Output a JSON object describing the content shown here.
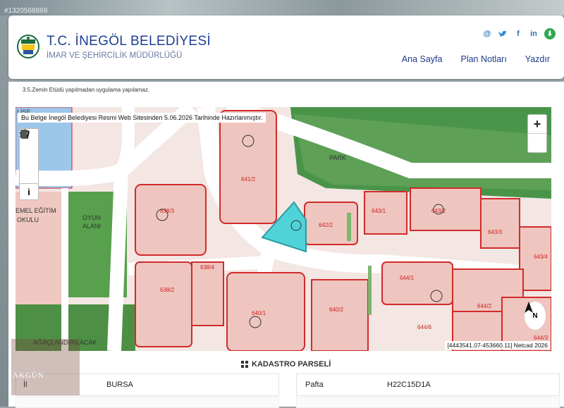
{
  "background_id": "#1320568869",
  "header": {
    "title": "T.C. İNEGÖL BELEDİYESİ",
    "subtitle": "İMAR VE ŞEHİRCİLİK MÜDÜRLÜĞÜ",
    "nav": [
      "Ana Sayfa",
      "Plan Notları",
      "Yazdır"
    ],
    "social_icons": [
      "email-icon",
      "twitter-icon",
      "facebook-icon",
      "linkedin-icon",
      "download-icon"
    ]
  },
  "content": {
    "note": "3.5.Zemin Etüdü yapılmadan uygulama yapılamaz.",
    "map": {
      "banner": "Bu Belge İnegöl Belediyesi Resmi Web Sitesinden 5.06.2026 Tarihinde Hazırlanmıştır.",
      "coords": "[4443541.07-453660.11] Netcad 2026",
      "north_label": "N",
      "zoom_in": "+",
      "info": "i",
      "parcels": [
        "641/2",
        "642/2",
        "643/1",
        "643/2",
        "643/3",
        "643/4",
        "644/1",
        "644/2",
        "644/3",
        "644/6",
        "640/1",
        "640/2",
        "638/2",
        "638/3",
        "638/4",
        "639/1"
      ],
      "labels": [
        "PARK",
        "LİSE",
        "EMEL EĞİTİM",
        "OKULU",
        "OYUN",
        "ALANI",
        "AĞAÇLANDIRILACAK",
        "KA:2"
      ]
    },
    "panel_title": "KADASTRO PARSELİ",
    "row": {
      "il_label": "İl",
      "il_value": "BURSA",
      "pafta_label": "Pafta",
      "pafta_value": "H22C15D1A"
    },
    "watermark": "AKGÜN"
  },
  "colors": {
    "title_blue": "#1f3f93",
    "parcel_fill": "#ecc3bd",
    "parcel_border": "#d22b2b",
    "green_area": "#3f8a3a",
    "selected_parcel": "#4fd3d9"
  }
}
